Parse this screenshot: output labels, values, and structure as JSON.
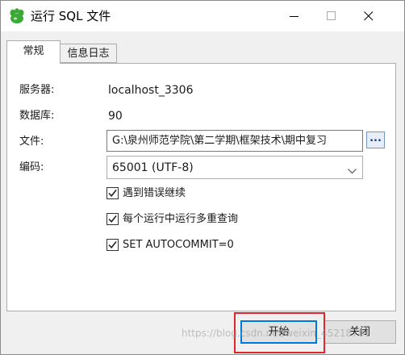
{
  "window": {
    "title": "运行 SQL 文件",
    "icon": "dolphin-icon"
  },
  "tabs": [
    {
      "label": "常规",
      "active": true
    },
    {
      "label": "信息日志",
      "active": false
    }
  ],
  "form": {
    "server_label": "服务器:",
    "server_value": "localhost_3306",
    "database_label": "数据库:",
    "database_value": "90",
    "file_label": "文件:",
    "file_value": "G:\\泉州师范学院\\第二学期\\框架技术\\期中复习",
    "browse_label": "...",
    "encoding_label": "编码:",
    "encoding_value": "65001 (UTF-8)"
  },
  "options": [
    {
      "label": "遇到错误继续",
      "checked": true
    },
    {
      "label": "每个运行中运行多重查询",
      "checked": true
    },
    {
      "label": "SET AUTOCOMMIT=0",
      "checked": true
    }
  ],
  "buttons": {
    "start": "开始",
    "close": "关闭"
  },
  "watermark": "https://blog.csdn.net/weixin_45218781",
  "colors": {
    "accent": "#0078d7",
    "highlight": "#e0262c",
    "app_icon": "#3aa935"
  }
}
